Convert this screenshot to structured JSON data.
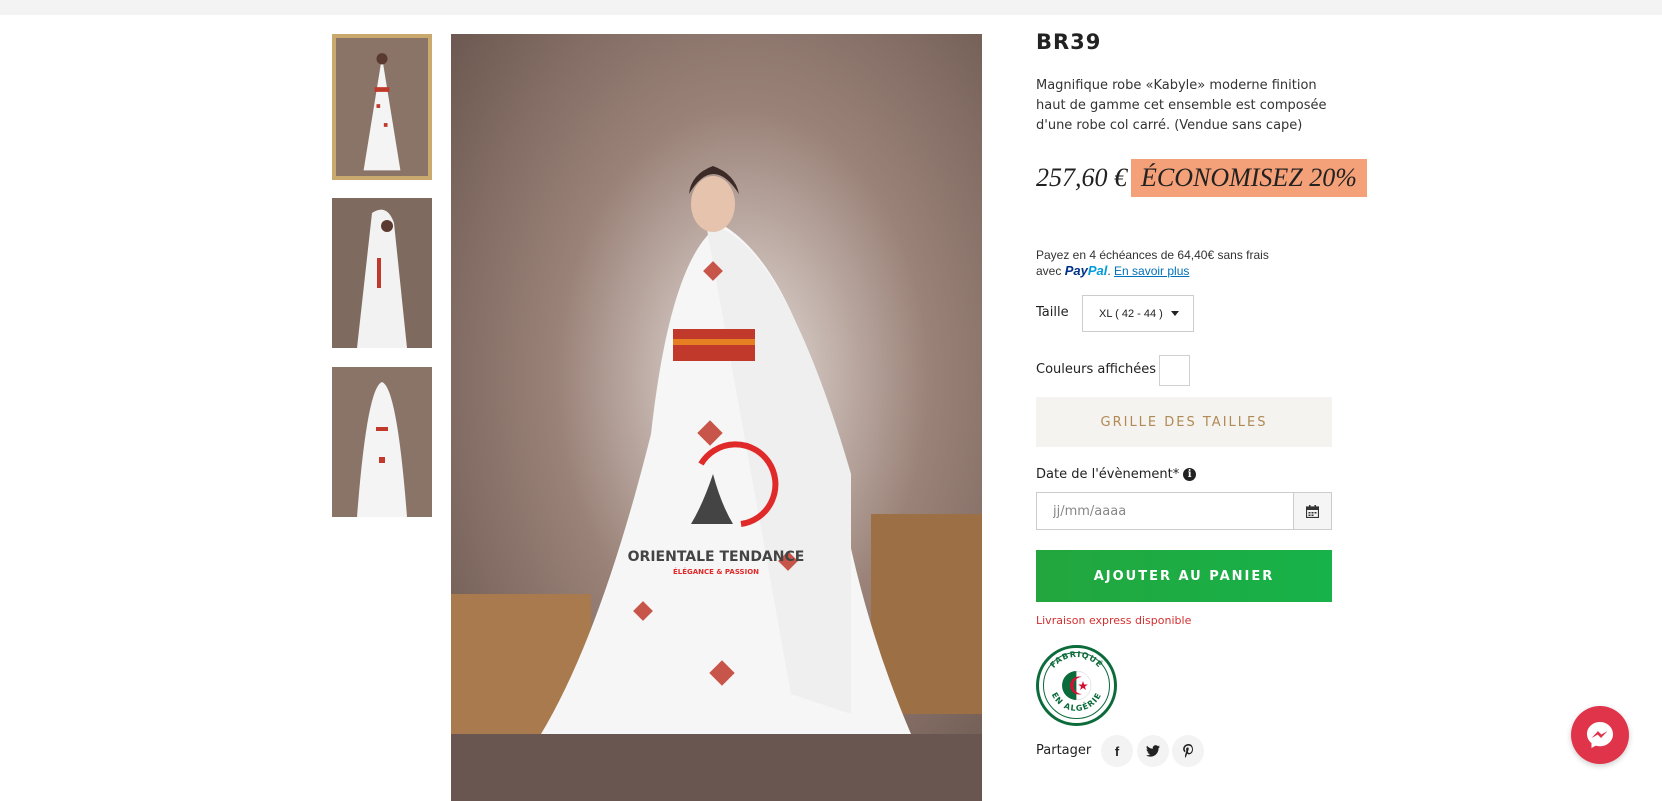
{
  "product": {
    "title": "BR39",
    "description": "Magnifique robe «Kabyle» moderne finition haut de gamme cet ensemble est composée d'une robe col carré. (Vendue sans cape)",
    "price": "257,60 €",
    "discount_badge": "ÉCONOMISEZ 20%"
  },
  "paypal": {
    "line1": "Payez en 4 échéances de 64,40€ sans frais",
    "avec": "avec",
    "logo_pay": "Pay",
    "logo_pal": "Pal",
    "learn_more": "En savoir plus"
  },
  "size": {
    "label": "Taille",
    "selected": "XL ( 42 - 44 )"
  },
  "colors": {
    "label": "Couleurs affichées"
  },
  "size_guide_label": "GRILLE DES TAILLES",
  "event_date": {
    "label": "Date de l'évènement*",
    "placeholder": "jj/mm/aaaa"
  },
  "add_to_cart_label": "AJOUTER AU PANIER",
  "delivery_note": "Livraison express disponible",
  "made_in": {
    "top": "FABRIQUÉ",
    "bottom": "EN ALGÉRIE"
  },
  "share": {
    "label": "Partager",
    "facebook": "f"
  },
  "watermark": {
    "brand": "ORIENTALE TENDANCE",
    "tagline": "ÉLÉGANCE & PASSION"
  },
  "icons": [
    "info-icon",
    "calendar-icon",
    "facebook-icon",
    "twitter-icon",
    "pinterest-icon",
    "messenger-icon",
    "caret-down-icon"
  ],
  "colors_palette": {
    "accent_gold": "#c9a96e",
    "badge": "#f4a078",
    "cart_green": "#1fab44",
    "delivery_red": "#d32f2f",
    "messenger": "#e0344a"
  }
}
